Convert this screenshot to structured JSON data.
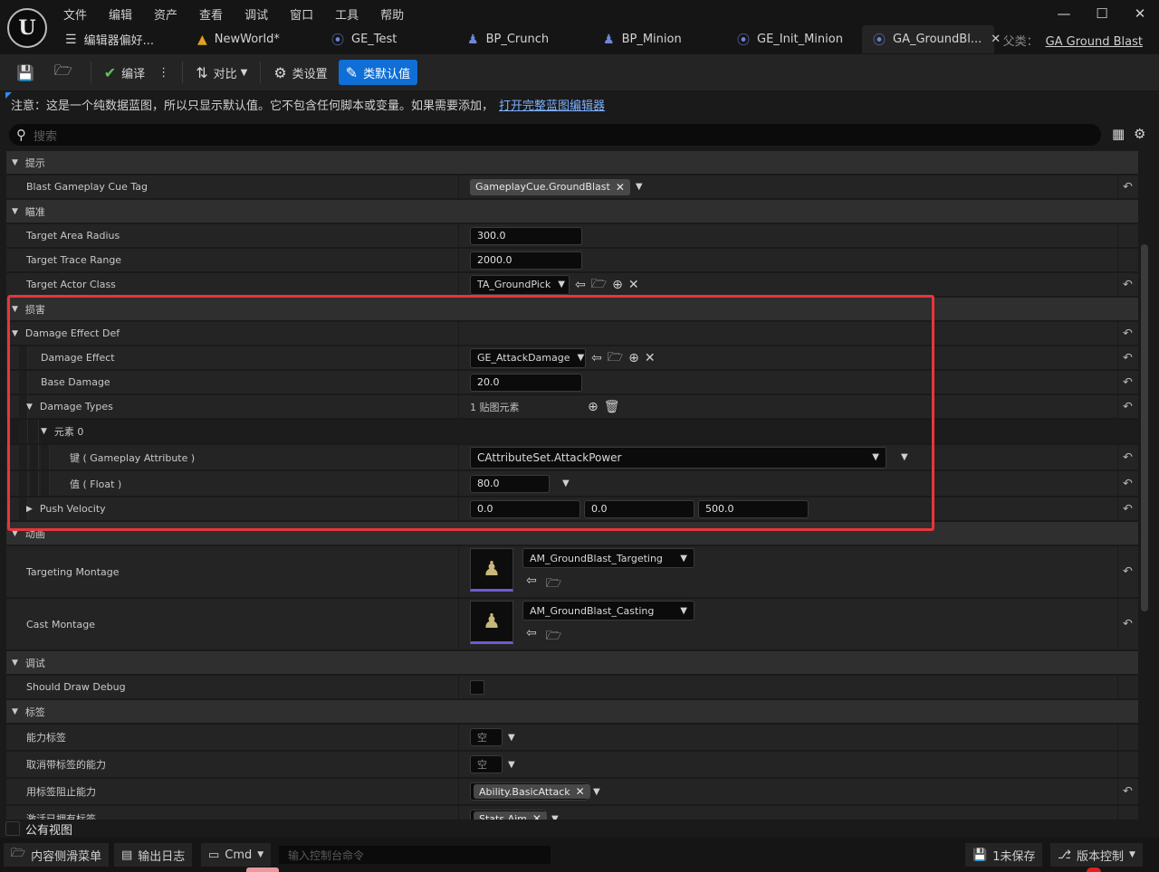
{
  "menu": [
    "文件",
    "编辑",
    "资产",
    "查看",
    "调试",
    "窗口",
    "工具",
    "帮助"
  ],
  "tabs": [
    {
      "label": "编辑器偏好...",
      "icon": "sliders-icon",
      "active": false
    },
    {
      "label": "NewWorld*",
      "icon": "level-icon",
      "active": false
    },
    {
      "label": "GE_Test",
      "icon": "blueprint-icon",
      "active": false
    },
    {
      "label": "BP_Crunch",
      "icon": "pawn-icon",
      "active": false
    },
    {
      "label": "BP_Minion",
      "icon": "pawn-icon",
      "active": false
    },
    {
      "label": "GE_Init_Minion",
      "icon": "blueprint-icon",
      "active": false
    },
    {
      "label": "GA_GroundBl...",
      "icon": "blueprint-icon",
      "active": true
    }
  ],
  "parent_class": {
    "prefix": "父类：",
    "value": "GA Ground Blast"
  },
  "toolbar": {
    "compile": "编译",
    "diff": "对比",
    "class_settings": "类设置",
    "class_defaults": "类默认值"
  },
  "notice": {
    "text": "注意：这是一个纯数据蓝图，所以只显示默认值。它不包含任何脚本或变量。如果需要添加，",
    "link": "打开完整蓝图编辑器"
  },
  "search": {
    "placeholder": "搜索"
  },
  "props": {
    "cat_hint": "提示",
    "blast_cue_tag": {
      "label": "Blast Gameplay Cue Tag",
      "value": "GameplayCue.GroundBlast"
    },
    "cat_aim": "瞄准",
    "target_area_radius": {
      "label": "Target Area Radius",
      "value": "300.0"
    },
    "target_trace_range": {
      "label": "Target Trace Range",
      "value": "2000.0"
    },
    "target_actor_class": {
      "label": "Target Actor Class",
      "value": "TA_GroundPick"
    },
    "cat_damage": "损害",
    "damage_effect_def": {
      "label": "Damage Effect Def"
    },
    "damage_effect": {
      "label": "Damage Effect",
      "value": "GE_AttackDamage"
    },
    "base_damage": {
      "label": "Base Damage",
      "value": "20.0"
    },
    "damage_types": {
      "label": "Damage Types",
      "value": "1 贴图元素"
    },
    "element0": {
      "label": "元素 0"
    },
    "key": {
      "label": "键 ( Gameplay Attribute )",
      "value": "CAttributeSet.AttackPower"
    },
    "val": {
      "label": "值 ( Float )",
      "value": "80.0"
    },
    "push_velocity": {
      "label": "Push Velocity",
      "x": "0.0",
      "y": "0.0",
      "z": "500.0"
    },
    "cat_anim": "动画",
    "targeting_montage": {
      "label": "Targeting Montage",
      "value": "AM_GroundBlast_Targeting"
    },
    "cast_montage": {
      "label": "Cast Montage",
      "value": "AM_GroundBlast_Casting"
    },
    "cat_debug": "调试",
    "should_draw_debug": {
      "label": "Should Draw Debug"
    },
    "cat_tags": "标签",
    "ability_tags": {
      "label": "能力标签",
      "value": "空"
    },
    "cancel_tags": {
      "label": "取消带标签的能力",
      "value": "空"
    },
    "block_tags": {
      "label": "用标签阻止能力",
      "value": "Ability.BasicAttack"
    },
    "activation_owned": {
      "label": "激活已拥有标签",
      "value": "Stats.Aim"
    }
  },
  "public_view": "公有视图",
  "statusbar": {
    "content_drawer": "内容侧滑菜单",
    "output_log": "输出日志",
    "cmd": "Cmd",
    "cmd_placeholder": "输入控制台命令",
    "unsaved": "1未保存",
    "source_control": "版本控制"
  }
}
